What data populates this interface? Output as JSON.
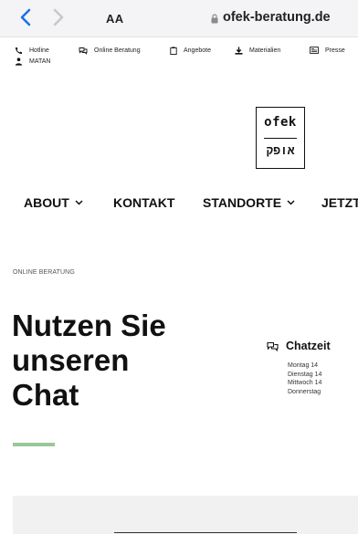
{
  "browser": {
    "text_size_button": "AA",
    "url": "ofek-beratung.de"
  },
  "utility_nav": {
    "items": [
      {
        "label": "Hotline",
        "icon": "phone-icon"
      },
      {
        "label": "Online Beratung",
        "icon": "chat-bubbles-icon"
      },
      {
        "label": "Angebote",
        "icon": "clipboard-icon"
      },
      {
        "label": "Materialien",
        "icon": "download-icon"
      },
      {
        "label": "Presse",
        "icon": "newspaper-icon"
      }
    ],
    "second_row": {
      "label": "MATAN",
      "icon": "person-icon"
    }
  },
  "logo": {
    "latin": "ofek",
    "hebrew": "אופק"
  },
  "main_nav": {
    "items": [
      {
        "label": "ABOUT",
        "has_dropdown": true
      },
      {
        "label": "KONTAKT",
        "has_dropdown": false
      },
      {
        "label": "STANDORTE",
        "has_dropdown": true
      },
      {
        "label": "JETZT",
        "has_dropdown": false
      }
    ]
  },
  "page": {
    "eyebrow": "ONLINE BERATUNG",
    "heading_lines": [
      "Nutzen Sie",
      "unseren",
      "Chat"
    ],
    "accent_color": "#98c89a"
  },
  "chat_times": {
    "title": "Chatzeit",
    "days": [
      "Montag 14",
      "Dienstag 14",
      "Mittwoch 14",
      "Donnerstag"
    ]
  }
}
